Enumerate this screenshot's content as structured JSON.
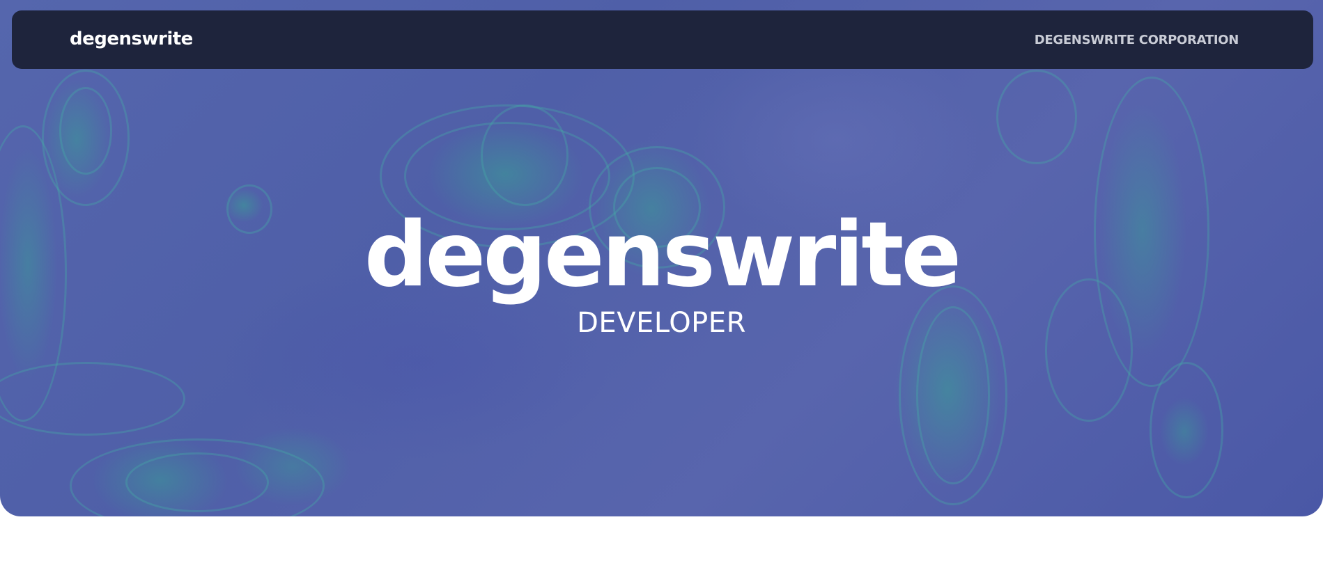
{
  "navbar": {
    "brand": "degenswrite",
    "corp_link": "DEGENSWRITE CORPORATION"
  },
  "hero": {
    "title": "degenswrite",
    "subtitle": "DEVELOPER"
  },
  "colors": {
    "navbar_bg": "#1b2136",
    "hero_bg": "#5464ac",
    "contour_accent": "#46afa5",
    "text": "#ffffff",
    "nav_link": "#c9ccd6"
  }
}
